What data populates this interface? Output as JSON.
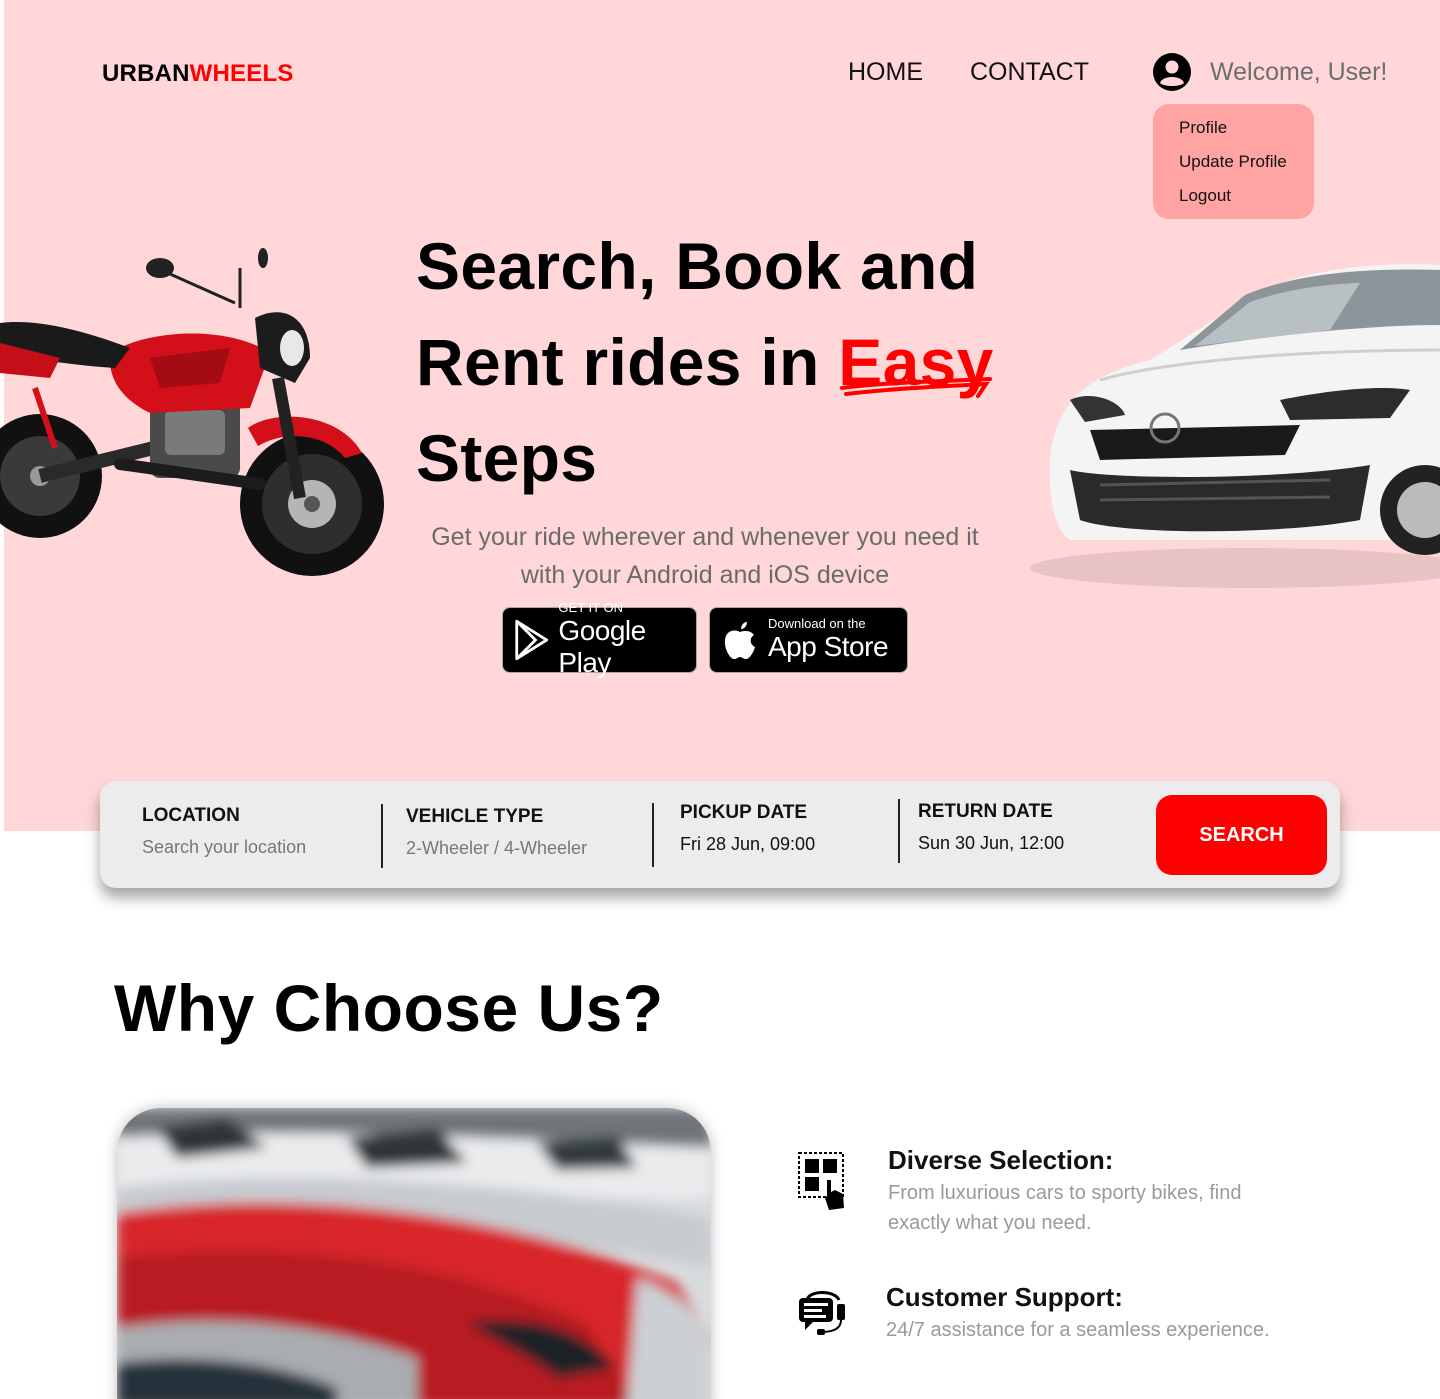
{
  "brand": {
    "part1": "URBAN",
    "part2": "WHEELS",
    "accent": "#ff0000"
  },
  "nav": {
    "home": "HOME",
    "contact": "CONTACT"
  },
  "user": {
    "welcome": "Welcome, User!",
    "icon": "user-circle-icon"
  },
  "user_menu": {
    "items": [
      "Profile",
      "Update Profile",
      "Logout"
    ]
  },
  "hero": {
    "line1": "Search, Book and",
    "line2_prefix": "Rent rides in ",
    "line2_highlight": "Easy",
    "line3": "Steps",
    "subtext": "Get your ride wherever and whenever you need it with your Android and iOS device",
    "google_play": {
      "small": "GET IT ON",
      "big": "Google Play",
      "icon": "google-play-icon"
    },
    "app_store": {
      "small": "Download on the",
      "big": "App Store",
      "icon": "apple-icon"
    }
  },
  "search": {
    "location": {
      "label": "LOCATION",
      "placeholder": "Search your location"
    },
    "vehicle_type": {
      "label": "VEHICLE TYPE",
      "placeholder": "2-Wheeler / 4-Wheeler"
    },
    "pickup_date": {
      "label": "PICKUP DATE",
      "value": "Fri 28 Jun, 09:00"
    },
    "return_date": {
      "label": "RETURN DATE",
      "value": "Sun 30 Jun, 12:00"
    },
    "button": "SEARCH"
  },
  "why": {
    "title": "Why Choose Us?",
    "features": [
      {
        "title": "Diverse Selection:",
        "desc": "From luxurious cars to sporty bikes, find exactly what you need.",
        "icon": "select-grid-icon"
      },
      {
        "title": "Customer Support:",
        "desc": "24/7 assistance for a seamless experience.",
        "icon": "support-chat-icon"
      }
    ]
  },
  "colors": {
    "hero_bg": "#ffd7d8",
    "dropdown_bg": "#ffa3a3",
    "search_button": "#ff0000",
    "search_bar_bg": "#ececec"
  }
}
